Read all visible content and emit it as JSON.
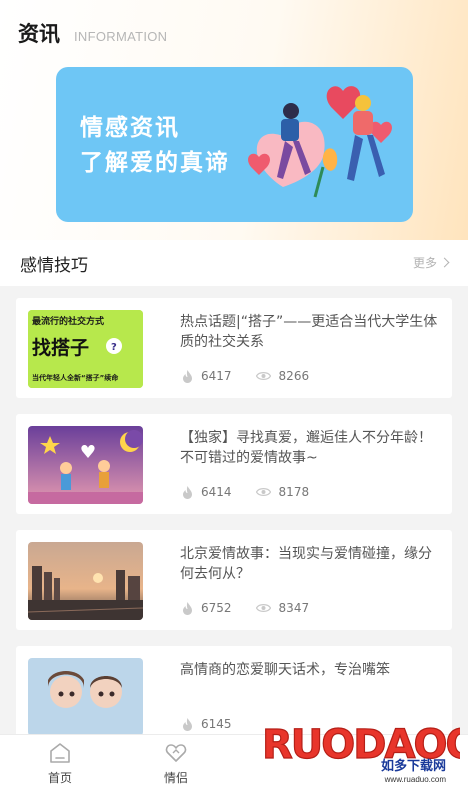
{
  "header": {
    "title": "资讯",
    "subtitle": "INFORMATION"
  },
  "banner": {
    "line1": "情感资讯",
    "line2": "了解爱的真谛"
  },
  "section": {
    "title": "感情技巧",
    "more": "更多"
  },
  "articles": [
    {
      "title": "热点话题|“搭子”——更适合当代大学生体质的社交关系",
      "likes": "6417",
      "views": "8266",
      "thumb_text": {
        "line1": "最流行的社交方式",
        "line2": "找搭子",
        "line3": "当代年轻人全新“搭子”续命"
      }
    },
    {
      "title": "【独家】寻找真爱，邂逅佳人不分年龄！不可错过的爱情故事~",
      "likes": "6414",
      "views": "8178"
    },
    {
      "title": "北京爱情故事：当现实与爱情碰撞，缘分何去何从？",
      "likes": "6752",
      "views": "8347"
    },
    {
      "title": "高情商的恋爱聊天话术，专治嘴笨",
      "likes": "6145",
      "views": ""
    }
  ],
  "tabbar": {
    "tabs": [
      {
        "label": "首页"
      },
      {
        "label": "情侣"
      }
    ]
  },
  "watermark": {
    "brand": "RUODAOO",
    "cn": "如多下载网",
    "site": "www.ruaduo.com"
  },
  "colors": {
    "banner": "#6ec6f5",
    "accent_orange": "#ffb347",
    "watermark_red": "#e8352b"
  }
}
